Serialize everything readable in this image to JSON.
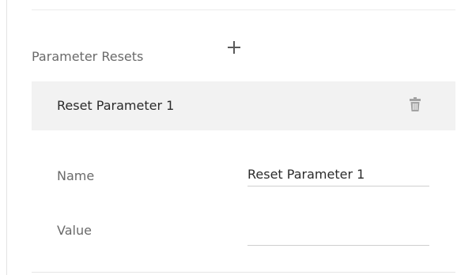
{
  "section": {
    "title": "Parameter Resets",
    "add_icon": "plus-icon"
  },
  "reset_item": {
    "label": "Reset Parameter 1",
    "delete_icon": "trash-icon"
  },
  "fields": {
    "name": {
      "label": "Name",
      "value": "Reset Parameter 1"
    },
    "value": {
      "label": "Value",
      "value": ""
    }
  },
  "colors": {
    "item_background": "#f2f2f2",
    "label_text": "#6a6a6a",
    "value_text": "#2b2b2b",
    "icon": "#5a5a5a",
    "trash_icon": "#a3a3a3"
  }
}
